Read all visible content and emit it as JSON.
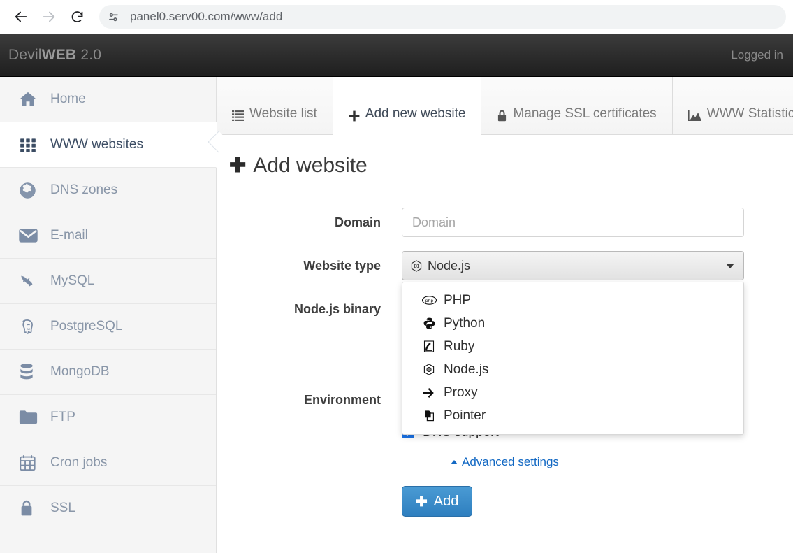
{
  "browser": {
    "back_icon": "arrow-left-icon",
    "forward_icon": "arrow-right-icon",
    "reload_icon": "reload-icon",
    "site_info_icon": "tune-icon",
    "url": "panel0.serv00.com/www/add"
  },
  "header": {
    "brand_prefix": "Devil",
    "brand_bold": "WEB",
    "brand_version": " 2.0",
    "logged_in": "Logged in"
  },
  "sidebar": {
    "items": [
      {
        "label": "Home",
        "icon": "home-icon",
        "active": false
      },
      {
        "label": "WWW websites",
        "icon": "grid-icon",
        "active": true
      },
      {
        "label": "DNS zones",
        "icon": "globe-icon",
        "active": false
      },
      {
        "label": "E-mail",
        "icon": "envelope-icon",
        "active": false
      },
      {
        "label": "MySQL",
        "icon": "dolphin-icon",
        "active": false
      },
      {
        "label": "PostgreSQL",
        "icon": "elephant-icon",
        "active": false
      },
      {
        "label": "MongoDB",
        "icon": "database-icon",
        "active": false
      },
      {
        "label": "FTP",
        "icon": "folder-icon",
        "active": false
      },
      {
        "label": "Cron jobs",
        "icon": "calendar-icon",
        "active": false
      },
      {
        "label": "SSL",
        "icon": "lock-icon",
        "active": false
      }
    ]
  },
  "tabs": [
    {
      "label": "Website list",
      "icon": "list-icon",
      "active": false
    },
    {
      "label": "Add new website",
      "icon": "plus-icon",
      "active": true
    },
    {
      "label": "Manage SSL certificates",
      "icon": "lock-icon",
      "active": false
    },
    {
      "label": "WWW Statistics",
      "icon": "area-chart-icon",
      "active": false
    }
  ],
  "page": {
    "title": "Add website",
    "title_icon": "plus-icon"
  },
  "form": {
    "domain": {
      "label": "Domain",
      "placeholder": "Domain",
      "value": ""
    },
    "website_type": {
      "label": "Website type",
      "selected": "Node.js",
      "selected_icon": "nodejs-icon",
      "open": true,
      "options": [
        {
          "label": "PHP",
          "icon": "php-icon"
        },
        {
          "label": "Python",
          "icon": "python-icon"
        },
        {
          "label": "Ruby",
          "icon": "ruby-icon"
        },
        {
          "label": "Node.js",
          "icon": "nodejs-icon"
        },
        {
          "label": "Proxy",
          "icon": "arrow-right-icon"
        },
        {
          "label": "Pointer",
          "icon": "copy-icon"
        }
      ]
    },
    "nodejs_binary": {
      "label": "Node.js binary"
    },
    "environment": {
      "label": "Environment"
    },
    "dns_support": {
      "label": "DNS support",
      "checked": true
    },
    "advanced_settings": {
      "label": "Advanced settings",
      "icon": "caret-up-icon"
    },
    "submit": {
      "label": "Add",
      "icon": "plus-icon"
    }
  },
  "colors": {
    "accent_blue": "#2e7fbf",
    "link_blue": "#1268c3",
    "checkbox_blue": "#1a73e8",
    "header_dark": "#2a2a2a",
    "sidebar_bg": "#f5f5f5",
    "sidebar_icon": "#7b8ca5"
  }
}
